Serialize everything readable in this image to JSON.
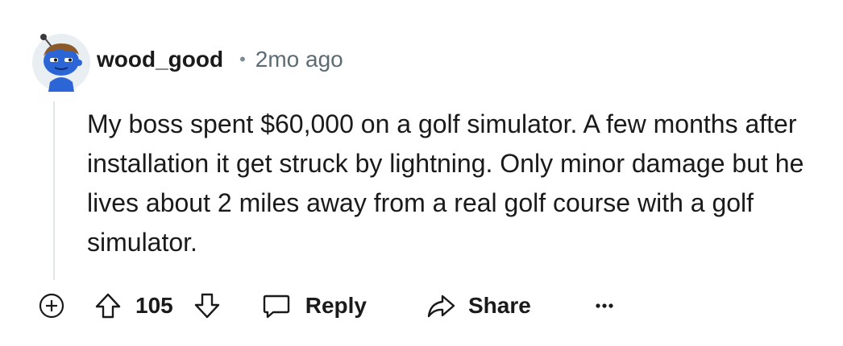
{
  "comment": {
    "username": "wood_good",
    "separator": "•",
    "time": "2mo ago",
    "text": "My boss spent $60,000 on a golf simulator. A few months after installation it get struck by lightning. Only minor damage but he lives about 2 miles away from a real golf course with a golf simulator.",
    "score": "105",
    "reply_label": "Reply",
    "share_label": "Share"
  },
  "icons": {
    "expand": "plus-circle-icon",
    "upvote": "arrow-up-icon",
    "downvote": "arrow-down-icon",
    "reply": "speech-bubble-icon",
    "share": "share-arrow-icon",
    "more": "ellipsis-icon"
  },
  "colors": {
    "avatar_body": "#2c66d6",
    "avatar_bg": "#e9eef2",
    "avatar_hair": "#8a5a2b",
    "thread_line": "#e3e6e8",
    "muted_text": "#5c6c74"
  }
}
